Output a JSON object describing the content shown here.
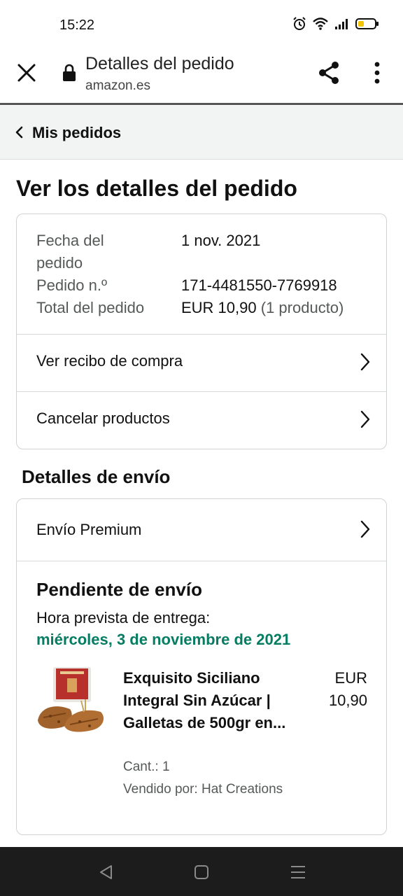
{
  "status_bar": {
    "time": "15:22"
  },
  "browser": {
    "title": "Detalles del pedido",
    "domain": "amazon.es"
  },
  "breadcrumb": {
    "label": "Mis pedidos"
  },
  "page": {
    "heading": "Ver los detalles del pedido"
  },
  "order": {
    "date_label": "Fecha del pedido",
    "date_value": "1 nov. 2021",
    "number_label": "Pedido n.º",
    "number_value": "171-4481550-7769918",
    "total_label": "Total del pedido",
    "total_value": "EUR 10,90",
    "total_count": "(1 producto)"
  },
  "actions": {
    "receipt": "Ver recibo de compra",
    "cancel": "Cancelar productos"
  },
  "shipping": {
    "heading": "Detalles de envío",
    "method": "Envío Premium",
    "status": "Pendiente de envío",
    "eta_label": "Hora prevista de entrega:",
    "eta_date": "miércoles, 3 de noviembre de 2021",
    "eta_color": "#067d62"
  },
  "product": {
    "title": "Exquisito Siciliano Integral Sin Azúcar | Galletas de 500gr en...",
    "price_currency": "EUR",
    "price_value": "10,90",
    "quantity": "Cant.: 1",
    "seller": "Vendido por: Hat Creations"
  },
  "icons": {
    "close": "close-icon",
    "lock": "lock-icon",
    "share": "share-icon",
    "menu": "more-vert-icon",
    "chevron_left": "chevron-left-icon",
    "chevron_right": "chevron-right-icon"
  }
}
